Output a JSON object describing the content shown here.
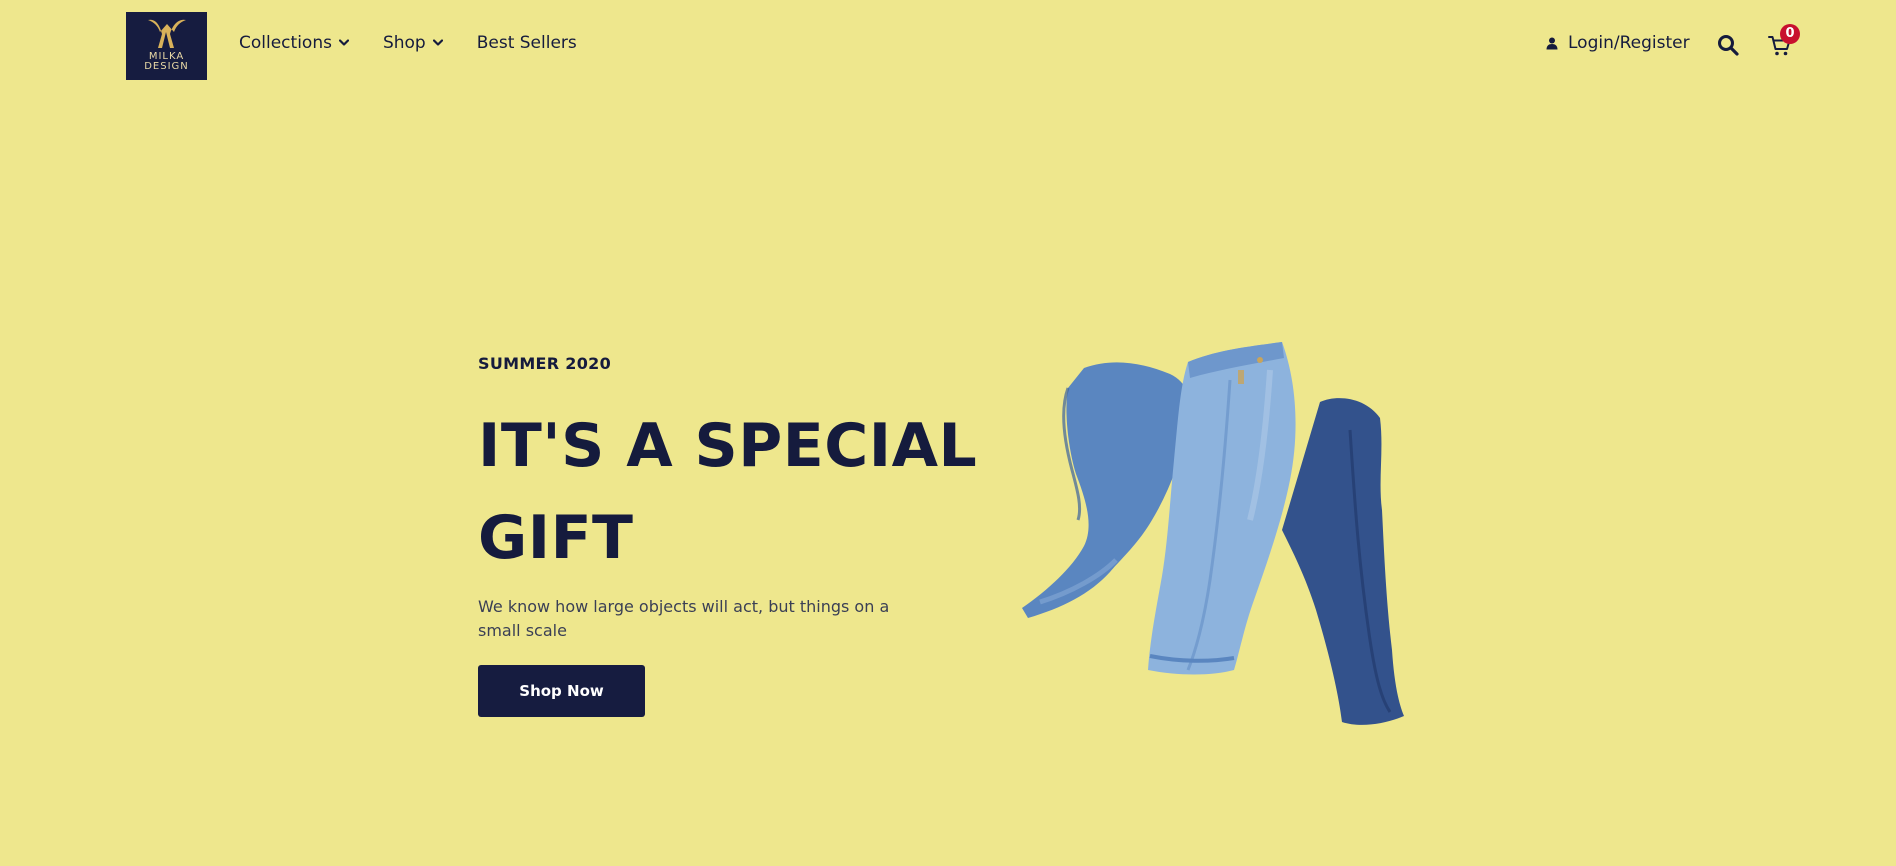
{
  "brand": {
    "logo_line1": "MILKA",
    "logo_line2": "DESIGN",
    "logo_bg": "#161C40",
    "logo_accent": "#D9B25A"
  },
  "nav": {
    "items": [
      {
        "label": "Collections",
        "has_dropdown": true
      },
      {
        "label": "Shop",
        "has_dropdown": true
      },
      {
        "label": "Best Sellers",
        "has_dropdown": false
      }
    ]
  },
  "header_actions": {
    "account_label": "Login/Register",
    "account_icon": "user-icon",
    "search_icon": "search-icon",
    "cart_icon": "cart-icon",
    "cart_count": "0"
  },
  "hero": {
    "eyebrow": "SUMMER 2020",
    "headline": "IT'S A SPECIAL GIFT",
    "subtext": "We know how large objects will act, but things on a small scale",
    "cta_label": "Shop Now",
    "image_icon": "jeans-illustration"
  },
  "colors": {
    "background": "#EEE78D",
    "primary": "#161C40",
    "badge": "#C8102E",
    "denim_light": "#8DB3DD",
    "denim_mid": "#5A86C0",
    "denim_dark": "#33528C"
  }
}
